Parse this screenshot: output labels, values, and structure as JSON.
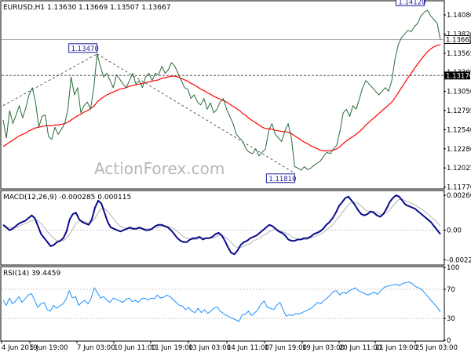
{
  "colors": {
    "background": "#ffffff",
    "grid": "#c8c8c8",
    "price": "#2a6a38",
    "ma": "#ff0000",
    "macd": "#0a0a8c",
    "signal": "#b4b4b4",
    "rsi": "#1e90ff",
    "annotation": "#1d1d99",
    "axis_text": "#000000"
  },
  "chart_data": [
    {
      "panel": "price",
      "type": "line",
      "title": "EURUSD,H1  1.13630 1.13669 1.13507 1.13667",
      "watermark": "ActionForex.com",
      "ylim": [
        1.116,
        1.142
      ],
      "y_ticks": [
        "1.14080",
        "1.13820",
        "1.13565",
        "1.13305",
        "1.13050",
        "1.12795",
        "1.12540",
        "1.12280",
        "1.12025",
        "1.11770"
      ],
      "current_price_label": "1.13667",
      "level_label": "1.13170",
      "level_value": 1.1317,
      "grid": true,
      "annotations": [
        {
          "text": "1.13470",
          "value": 1.1347,
          "x_index": 29
        },
        {
          "text": "1.11810",
          "value": 1.1181,
          "x_index": 90
        },
        {
          "text": "1.14120",
          "value": 1.1412,
          "x_index": 130
        }
      ],
      "trendlines": [
        {
          "from": {
            "x_index": 0,
            "value": 1.1275
          },
          "to": {
            "x_index": 29,
            "value": 1.1347
          }
        },
        {
          "from": {
            "x_index": 29,
            "value": 1.1347
          },
          "to": {
            "x_index": 90,
            "value": 1.1181
          }
        }
      ],
      "series": [
        {
          "key": "price",
          "values": [
            1.1255,
            1.123,
            1.1268,
            1.125,
            1.1262,
            1.1275,
            1.1258,
            1.1272,
            1.129,
            1.13,
            1.128,
            1.1245,
            1.126,
            1.1262,
            1.1232,
            1.1228,
            1.1245,
            1.1235,
            1.1242,
            1.125,
            1.127,
            1.1315,
            1.129,
            1.13,
            1.1265,
            1.1275,
            1.128,
            1.127,
            1.13,
            1.1347,
            1.133,
            1.1315,
            1.132,
            1.131,
            1.13,
            1.1318,
            1.1312,
            1.1305,
            1.13,
            1.131,
            1.132,
            1.1305,
            1.131,
            1.13,
            1.1315,
            1.132,
            1.131,
            1.132,
            1.1318,
            1.133,
            1.132,
            1.1325,
            1.1335,
            1.133,
            1.132,
            1.131,
            1.13,
            1.1298,
            1.1285,
            1.129,
            1.128,
            1.1276,
            1.1285,
            1.127,
            1.1279,
            1.1265,
            1.127,
            1.128,
            1.1285,
            1.127,
            1.126,
            1.125,
            1.1235,
            1.123,
            1.1225,
            1.1215,
            1.121,
            1.1208,
            1.1215,
            1.1205,
            1.121,
            1.1215,
            1.124,
            1.125,
            1.1235,
            1.123,
            1.1225,
            1.124,
            1.125,
            1.123,
            1.119,
            1.1188,
            1.1185,
            1.119,
            1.1186,
            1.1188,
            1.1192,
            1.1195,
            1.1198,
            1.1205,
            1.121,
            1.1208,
            1.1215,
            1.122,
            1.124,
            1.1265,
            1.127,
            1.126,
            1.1275,
            1.127,
            1.1285,
            1.13,
            1.131,
            1.1305,
            1.13,
            1.1295,
            1.129,
            1.1295,
            1.13,
            1.1295,
            1.131,
            1.134,
            1.136,
            1.137,
            1.1375,
            1.138,
            1.1378,
            1.1385,
            1.139,
            1.14,
            1.1405,
            1.1408,
            1.14,
            1.1395,
            1.139,
            1.1367
          ]
        },
        {
          "key": "ma",
          "values": [
            1.1218,
            1.1221,
            1.1224,
            1.1227,
            1.123,
            1.1233,
            1.1235,
            1.1237,
            1.124,
            1.1242,
            1.1244,
            1.1245,
            1.1246,
            1.1247,
            1.1247,
            1.1247,
            1.1248,
            1.1248,
            1.1249,
            1.125,
            1.1252,
            1.1255,
            1.1258,
            1.1261,
            1.1263,
            1.1266,
            1.1268,
            1.1271,
            1.1274,
            1.128,
            1.1284,
            1.1287,
            1.129,
            1.1292,
            1.1294,
            1.1296,
            1.1298,
            1.1299,
            1.13,
            1.1302,
            1.1303,
            1.1304,
            1.1305,
            1.1306,
            1.1307,
            1.1308,
            1.1309,
            1.131,
            1.1311,
            1.1313,
            1.1314,
            1.1315,
            1.1316,
            1.1316,
            1.1315,
            1.1313,
            1.1311,
            1.1309,
            1.1306,
            1.1304,
            1.1301,
            1.1298,
            1.1296,
            1.1293,
            1.1291,
            1.1288,
            1.1286,
            1.1284,
            1.1282,
            1.128,
            1.1277,
            1.1274,
            1.1271,
            1.1268,
            1.1264,
            1.1261,
            1.1257,
            1.1254,
            1.1251,
            1.1248,
            1.1245,
            1.1243,
            1.1243,
            1.1242,
            1.1241,
            1.124,
            1.1239,
            1.1239,
            1.1238,
            1.1236,
            1.1233,
            1.123,
            1.1227,
            1.1224,
            1.1222,
            1.1219,
            1.1217,
            1.1215,
            1.1213,
            1.1212,
            1.1212,
            1.1212,
            1.1213,
            1.1215,
            1.1218,
            1.1222,
            1.1226,
            1.1229,
            1.1232,
            1.1235,
            1.1239,
            1.1243,
            1.1248,
            1.1252,
            1.1256,
            1.126,
            1.1264,
            1.1268,
            1.1272,
            1.1276,
            1.128,
            1.1286,
            1.1293,
            1.13,
            1.1307,
            1.1314,
            1.132,
            1.1327,
            1.1333,
            1.1339,
            1.1345,
            1.135,
            1.1354,
            1.1357,
            1.1359,
            1.136
          ]
        }
      ]
    },
    {
      "panel": "macd",
      "type": "line",
      "title": "MACD(12,26,9) -0.000285 0.000115",
      "ylim": [
        -0.00255,
        0.0029
      ],
      "y_ticks": [
        "0.002601",
        "0.00",
        "-0.002218"
      ],
      "zero_label": "0.00",
      "grid": true,
      "series": [
        {
          "key": "macd",
          "values": [
            0.0004,
            0.0002,
            0.0,
            0.0001,
            0.0003,
            0.0005,
            0.0006,
            0.0007,
            0.0009,
            0.0011,
            0.0009,
            0.0003,
            -0.0003,
            -0.0006,
            -0.0009,
            -0.0012,
            -0.0011,
            -0.0009,
            -0.0008,
            -0.0006,
            -0.0001,
            0.0008,
            0.0012,
            0.0013,
            0.0008,
            0.0006,
            0.0005,
            0.0004,
            0.0008,
            0.0017,
            0.0022,
            0.002,
            0.0013,
            0.0006,
            0.0002,
            0.0001,
            0.0,
            -0.0001,
            0.0,
            0.0001,
            0.0002,
            0.0001,
            0.0001,
            0.0002,
            0.0001,
            0.0,
            0.0,
            0.0001,
            0.0003,
            0.0004,
            0.0004,
            0.0003,
            0.0002,
            0.0,
            -0.0003,
            -0.0006,
            -0.0008,
            -0.0009,
            -0.0009,
            -0.0007,
            -0.0006,
            -0.0006,
            -0.0005,
            -0.0007,
            -0.0006,
            -0.0006,
            -0.0005,
            -0.0003,
            -0.0002,
            -0.0004,
            -0.0008,
            -0.0013,
            -0.0017,
            -0.0018,
            -0.0015,
            -0.0011,
            -0.0009,
            -0.0008,
            -0.0006,
            -0.0005,
            -0.0004,
            -0.0002,
            0.0,
            0.0002,
            0.0004,
            0.0003,
            0.0001,
            -0.0001,
            -0.0002,
            -0.0004,
            -0.0007,
            -0.0008,
            -0.0008,
            -0.0007,
            -0.0007,
            -0.0006,
            -0.0006,
            -0.0005,
            -0.0003,
            -0.0002,
            -0.0001,
            0.0001,
            0.0004,
            0.0006,
            0.0009,
            0.0013,
            0.0018,
            0.0021,
            0.0024,
            0.0025,
            0.0022,
            0.0019,
            0.0015,
            0.0012,
            0.0011,
            0.0012,
            0.0014,
            0.0013,
            0.0011,
            0.001,
            0.0012,
            0.0016,
            0.0021,
            0.0024,
            0.0026,
            0.0025,
            0.0022,
            0.0019,
            0.0018,
            0.0017,
            0.0016,
            0.0014,
            0.0012,
            0.001,
            0.0008,
            0.0006,
            0.0003,
            0.0,
            -0.0003
          ]
        },
        {
          "key": "signal",
          "values": [
            0.0004,
            0.0003,
            0.0002,
            0.0002,
            0.0002,
            0.0003,
            0.0004,
            0.0005,
            0.0006,
            0.0007,
            0.0008,
            0.0007,
            0.0005,
            0.0002,
            -0.0001,
            -0.0004,
            -0.0006,
            -0.0008,
            -0.0008,
            -0.0008,
            -0.0006,
            -0.0003,
            0.0001,
            0.0005,
            0.0007,
            0.0007,
            0.0006,
            0.0005,
            0.0006,
            0.0009,
            0.0013,
            0.0016,
            0.0016,
            0.0014,
            0.0011,
            0.0008,
            0.0005,
            0.0003,
            0.0002,
            0.0001,
            0.0001,
            0.0001,
            0.0001,
            0.0001,
            0.0001,
            0.0001,
            0.0001,
            0.0001,
            0.0002,
            0.0002,
            0.0003,
            0.0003,
            0.0003,
            0.0002,
            0.0001,
            -0.0001,
            -0.0003,
            -0.0005,
            -0.0006,
            -0.0007,
            -0.0007,
            -0.0007,
            -0.0006,
            -0.0006,
            -0.0006,
            -0.0006,
            -0.0006,
            -0.0005,
            -0.0004,
            -0.0004,
            -0.0005,
            -0.0007,
            -0.0009,
            -0.0012,
            -0.0013,
            -0.0013,
            -0.0012,
            -0.0011,
            -0.001,
            -0.0008,
            -0.0007,
            -0.0006,
            -0.0004,
            -0.0003,
            -0.0001,
            0.0,
            0.0001,
            0.0,
            -0.0001,
            -0.0002,
            -0.0003,
            -0.0005,
            -0.0006,
            -0.0007,
            -0.0007,
            -0.0007,
            -0.0007,
            -0.0006,
            -0.0005,
            -0.0004,
            -0.0003,
            -0.0002,
            0.0,
            0.0002,
            0.0004,
            0.0007,
            0.001,
            0.0013,
            0.0016,
            0.0019,
            0.0021,
            0.0021,
            0.002,
            0.0018,
            0.0016,
            0.0014,
            0.0014,
            0.0014,
            0.0013,
            0.0012,
            0.0012,
            0.0013,
            0.0015,
            0.0018,
            0.0021,
            0.0023,
            0.0023,
            0.0022,
            0.0021,
            0.002,
            0.0019,
            0.0017,
            0.0016,
            0.0014,
            0.0012,
            0.001,
            0.0008,
            0.0006,
            0.0003
          ]
        }
      ]
    },
    {
      "panel": "rsi",
      "type": "line",
      "title": "RSI(14) 39.4459",
      "ylim": [
        0,
        100
      ],
      "y_ticks": [
        "100",
        "70",
        "30",
        "0"
      ],
      "levels": [
        70,
        30
      ],
      "grid": true,
      "series": [
        {
          "key": "rsi",
          "values": [
            55,
            48,
            58,
            50,
            54,
            60,
            52,
            57,
            62,
            64,
            55,
            45,
            50,
            52,
            42,
            40,
            48,
            44,
            47,
            50,
            56,
            68,
            58,
            60,
            48,
            52,
            55,
            50,
            58,
            72,
            65,
            58,
            60,
            55,
            52,
            58,
            56,
            54,
            52,
            56,
            58,
            53,
            55,
            52,
            57,
            58,
            55,
            58,
            57,
            62,
            58,
            59,
            62,
            60,
            56,
            52,
            48,
            47,
            42,
            45,
            40,
            38,
            44,
            38,
            42,
            37,
            40,
            44,
            46,
            40,
            37,
            34,
            32,
            30,
            28,
            26,
            35,
            36,
            40,
            34,
            38,
            42,
            50,
            54,
            45,
            44,
            42,
            48,
            52,
            42,
            33,
            35,
            34,
            37,
            36,
            38,
            40,
            42,
            44,
            48,
            52,
            50,
            55,
            58,
            62,
            67,
            68,
            62,
            66,
            64,
            68,
            70,
            72,
            68,
            66,
            64,
            62,
            64,
            66,
            63,
            68,
            72,
            74,
            75,
            76,
            77,
            75,
            78,
            79,
            80,
            78,
            74,
            72,
            70,
            65,
            60,
            55,
            50,
            45,
            39
          ]
        }
      ]
    }
  ],
  "x_axis_labels": [
    "4 Jun 2019",
    "5 Jun 19:00",
    "7 Jun 03:00",
    "10 Jun 11:00",
    "11 Jun 19:00",
    "13 Jun 03:00",
    "14 Jun 11:00",
    "17 Jun 19:00",
    "19 Jun 03:00",
    "20 Jun 11:00",
    "21 Jun 19:00",
    "25 Jun 03:00"
  ]
}
